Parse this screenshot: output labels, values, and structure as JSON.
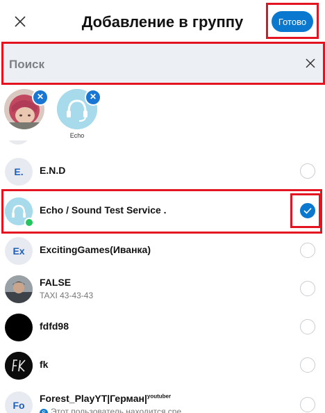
{
  "header": {
    "title": "Добавление в группу",
    "done_label": "Готово"
  },
  "search": {
    "placeholder": "Поиск"
  },
  "selected": [
    {
      "label": "",
      "icon": "anime-avatar"
    },
    {
      "label": "Echo",
      "icon": "headset-icon"
    }
  ],
  "contacts": [
    {
      "initials": "E.",
      "name": "E.N.D",
      "sub": "",
      "checked": false
    },
    {
      "initials": "",
      "name": "Echo / Sound Test Service .",
      "sub": "",
      "checked": true,
      "online": true
    },
    {
      "initials": "Ex",
      "name": "ExcitingGames(Иванка)",
      "sub": "",
      "checked": false
    },
    {
      "initials": "",
      "name": "FALSE",
      "sub": "TAXI 43-43-43",
      "checked": false
    },
    {
      "initials": "",
      "name": "fdfd98",
      "sub": "",
      "checked": false
    },
    {
      "initials": "",
      "name": "fk",
      "sub": "",
      "checked": false
    },
    {
      "initials": "Fo",
      "name": "Forest_PlayYT|Герман|",
      "name_sup": "youtuber",
      "sub": "Этот пользователь находится сре",
      "checked": false
    }
  ],
  "colors": {
    "accent": "#0b78d0",
    "highlight": "#e3141f",
    "online": "#22c55e"
  }
}
